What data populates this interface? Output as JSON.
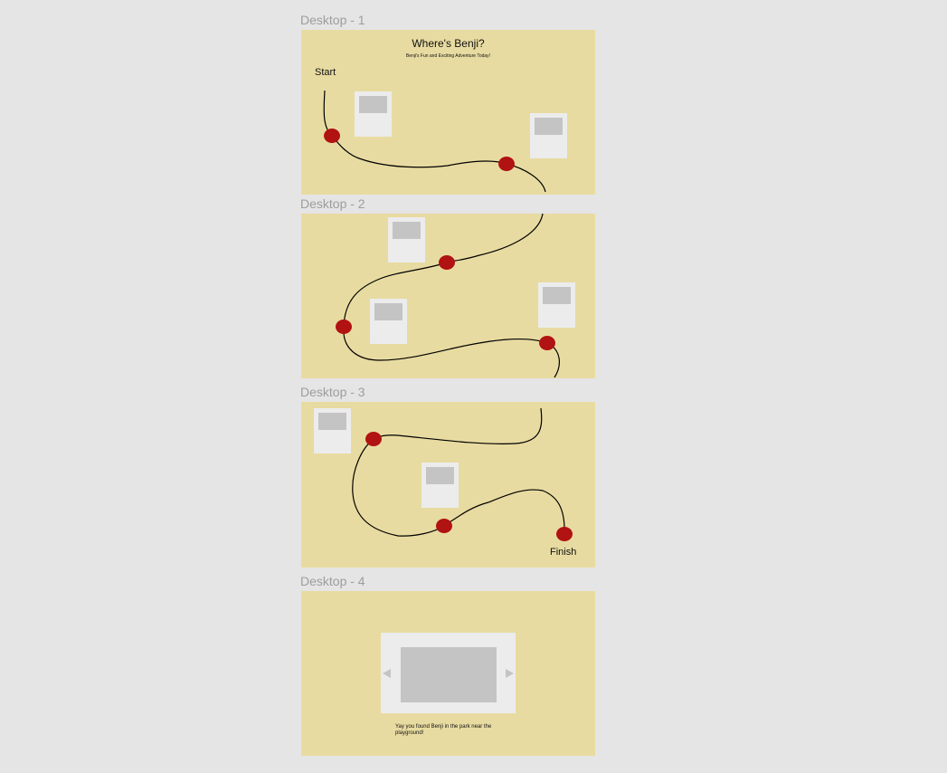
{
  "frames": {
    "f1": {
      "label": "Desktop - 1"
    },
    "f2": {
      "label": "Desktop - 2"
    },
    "f3": {
      "label": "Desktop - 3"
    },
    "f4": {
      "label": "Desktop - 4"
    }
  },
  "page": {
    "title": "Where's Benji?",
    "subtitle": "Benji's Fun and Exciting Adventure Today!",
    "start_label": "Start",
    "finish_label": "Finish",
    "found_message": "Yay you found Benji in the park near the playground!"
  },
  "carousel": {
    "prev_icon": "triangle-left-icon",
    "next_icon": "triangle-right-icon"
  },
  "colors": {
    "canvas": "#e5e5e5",
    "frame_bg": "#e8dba1",
    "marker": "#b11212",
    "card": "#ececec",
    "placeholder": "#c4c4c4"
  }
}
